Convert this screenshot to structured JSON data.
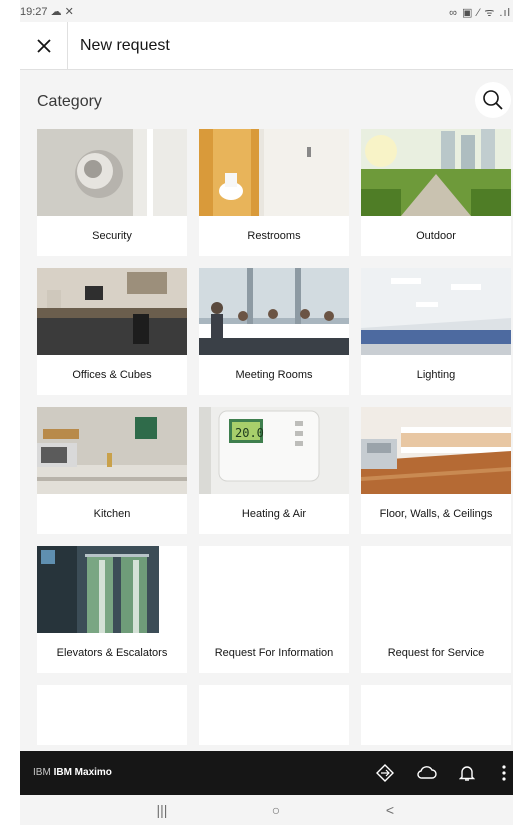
{
  "status_bar": {
    "time": "19:27 ☁ ✕",
    "right": "∞ ▣ ⁄ ᯤ .ıl"
  },
  "header": {
    "title": "New request",
    "close_icon": "close-icon"
  },
  "section": {
    "title": "Category",
    "search_icon": "search-icon"
  },
  "tiles": [
    {
      "label": "Security",
      "image": "door-knob"
    },
    {
      "label": "Restrooms",
      "image": "restroom"
    },
    {
      "label": "Outdoor",
      "image": "outdoor-park"
    },
    {
      "label": "Offices & Cubes",
      "image": "office-desk"
    },
    {
      "label": "Meeting Rooms",
      "image": "meeting-room"
    },
    {
      "label": "Lighting",
      "image": "ceiling-lights"
    },
    {
      "label": "Kitchen",
      "image": "kitchen"
    },
    {
      "label": "Heating & Air",
      "image": "thermostat"
    },
    {
      "label": "Floor, Walls, & Ceilings",
      "image": "floor-walls"
    },
    {
      "label": "Elevators & Escalators",
      "image": "elevator"
    },
    {
      "label": "Request For Information",
      "image": ""
    },
    {
      "label": "Request for Service",
      "image": ""
    },
    {
      "label": "",
      "image": ""
    },
    {
      "label": "",
      "image": ""
    },
    {
      "label": "",
      "image": ""
    }
  ],
  "app_bar": {
    "brand_prefix": "IBM",
    "brand_name": "IBM Maximo",
    "icons": [
      "navigation-icon",
      "cloud-icon",
      "bell-icon",
      "more-icon"
    ]
  },
  "nav_bar": {
    "recent": "|||",
    "home": "○",
    "back": "<"
  },
  "colors": {
    "app_bar": "#161616",
    "background": "#f4f4f4",
    "tile": "#ffffff"
  }
}
